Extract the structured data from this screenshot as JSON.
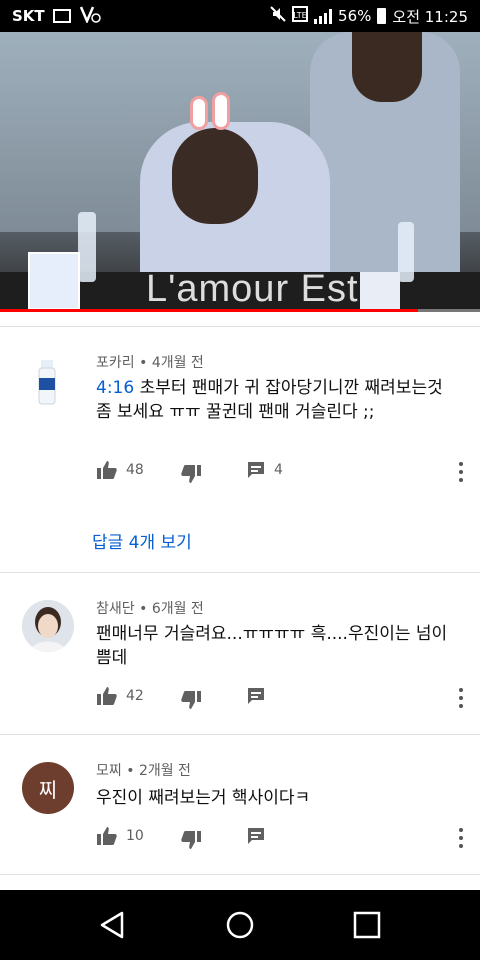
{
  "status_bar": {
    "carrier": "SKT",
    "battery": "56%",
    "time": "오전 11:25"
  },
  "video": {
    "overlay_text": "L'amour Est",
    "progress_percent": 87,
    "colors": {
      "progress": "#ff0000"
    }
  },
  "comments": [
    {
      "author": "포카리",
      "age": "4개월 전",
      "timestamp": "4:16",
      "text": " 초부터 팬매가 귀 잡아당기니깐 째려보는것좀 보세요 ㅠㅠ 꿀귄데 팬매 거슬린다 ;;",
      "likes": "48",
      "reply_count": "4",
      "avatar_icon": "pocari-bottle-icon"
    },
    {
      "author": "참새단",
      "age": "6개월 전",
      "text": "팬매너무 거슬려요...ㅠㅠㅠㅠ 흑....우진이는 넘이쁨데",
      "likes": "42",
      "avatar_icon": "profile-photo-avatar"
    },
    {
      "author": "모찌",
      "age": "2개월 전",
      "text": "우진이 째려보는거 핵사이다ㅋ",
      "likes": "10",
      "avatar_letter": "찌",
      "avatar_color": "#6d3d2d"
    }
  ],
  "view_replies_label": "답글 4개 보기",
  "colors": {
    "link": "#065fd4",
    "meta": "#606060"
  }
}
